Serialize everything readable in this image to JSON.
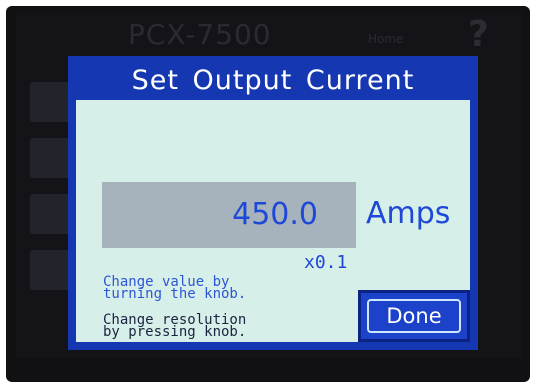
{
  "background": {
    "device_model": "PCX-7500",
    "home_label": "Home",
    "help_symbol": "?"
  },
  "dialog": {
    "title": "Set Output Current",
    "value": "450.0",
    "unit": "Amps",
    "resolution": "x0.1",
    "hint_change_value": [
      "Change value by",
      "turning the knob."
    ],
    "hint_change_resolution": [
      "Change resolution",
      "by pressing knob."
    ],
    "done_label": "Done"
  },
  "colors": {
    "dialog_frame": "#1538b2",
    "dialog_body": "#d6efe8",
    "value_box": "#a7b3bc",
    "accent_text": "#1e49d8"
  }
}
